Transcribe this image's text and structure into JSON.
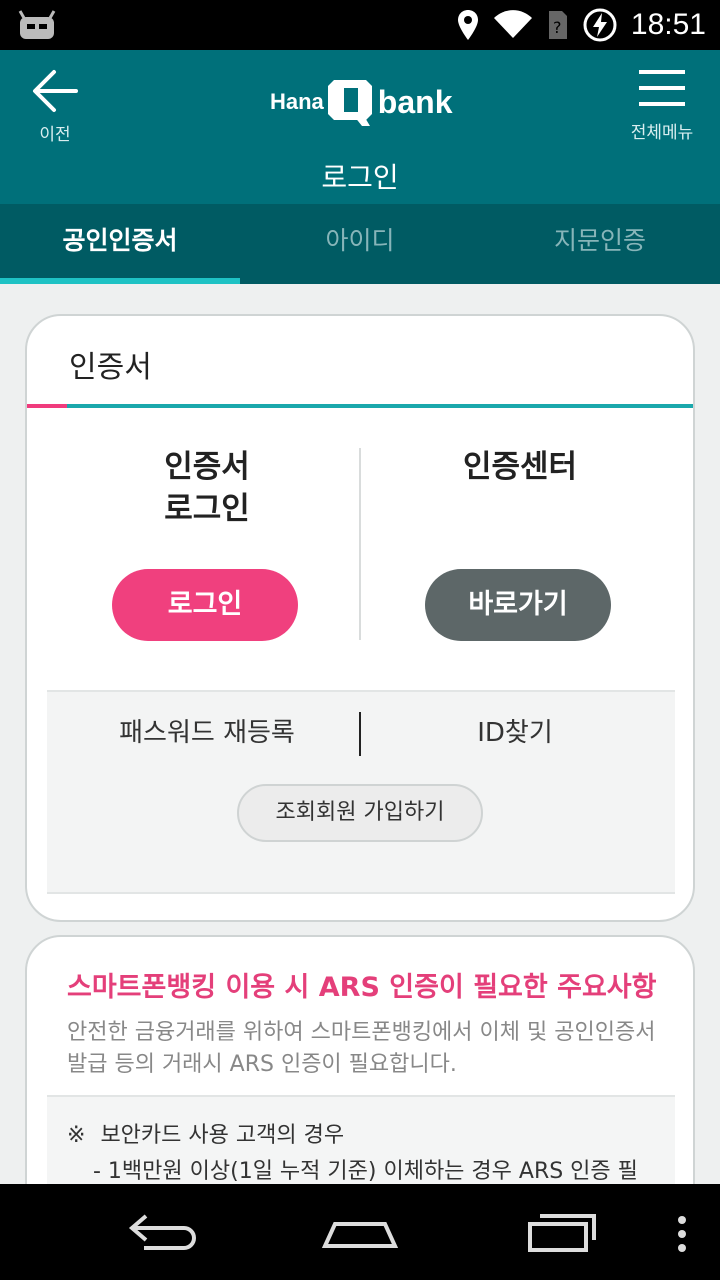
{
  "status_bar": {
    "time": "18:51",
    "icons": [
      "android-robot-icon",
      "location-icon",
      "wifi-icon",
      "no-sim-icon",
      "battery-charging-icon"
    ]
  },
  "header": {
    "back_label": "이전",
    "menu_label": "전체메뉴",
    "logo_left": "Hana",
    "logo_right": "bank",
    "title": "로그인"
  },
  "tabs": [
    {
      "label": "공인인증서",
      "active": true
    },
    {
      "label": "아이디",
      "active": false
    },
    {
      "label": "지문인증",
      "active": false
    }
  ],
  "cert_card": {
    "title": "인증서",
    "left_title": "인증서\n로그인",
    "left_button": "로그인",
    "right_title": "인증센터",
    "right_button": "바로가기",
    "password_link": "패스워드 재등록",
    "id_link": "ID찾기",
    "join_button": "조회회원 가입하기"
  },
  "notice_card": {
    "title": "스마트폰뱅킹 이용 시 ARS 인증이 필요한 주요사항",
    "body": "안전한 금융거래를 위하여 스마트폰뱅킹에서 이체 및 공인인증서 발급 등의 거래시 ARS 인증이 필요합니다.",
    "item_mark": "※",
    "item_title": "보안카드 사용 고객의 경우",
    "item_sub": "- 1백만원 이상(1일 누적 기준) 이체하는 경우 ARS 인증 필"
  },
  "colors": {
    "header": "#00707a",
    "tabs": "#005b63",
    "accent_pink": "#f0407e",
    "accent_teal": "#1ec2c4",
    "dark_button": "#5d6768"
  }
}
